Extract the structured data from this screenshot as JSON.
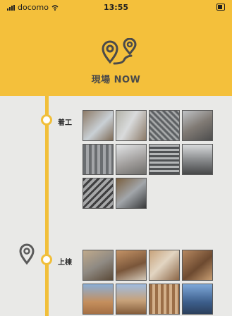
{
  "status_bar": {
    "carrier": "docomo",
    "time": "13:55"
  },
  "header": {
    "title": "現場 NOW"
  },
  "timeline": [
    {
      "label": "着工"
    },
    {
      "label": "上棟"
    }
  ],
  "colors": {
    "accent": "#f4c03b",
    "timeline": "#f1bf3a",
    "background": "#e9e9e7",
    "icon_dark": "#4a4a4a"
  },
  "icons": [
    "signal-icon",
    "wifi-icon",
    "battery-icon",
    "location-route-icon",
    "location-pin-icon"
  ]
}
